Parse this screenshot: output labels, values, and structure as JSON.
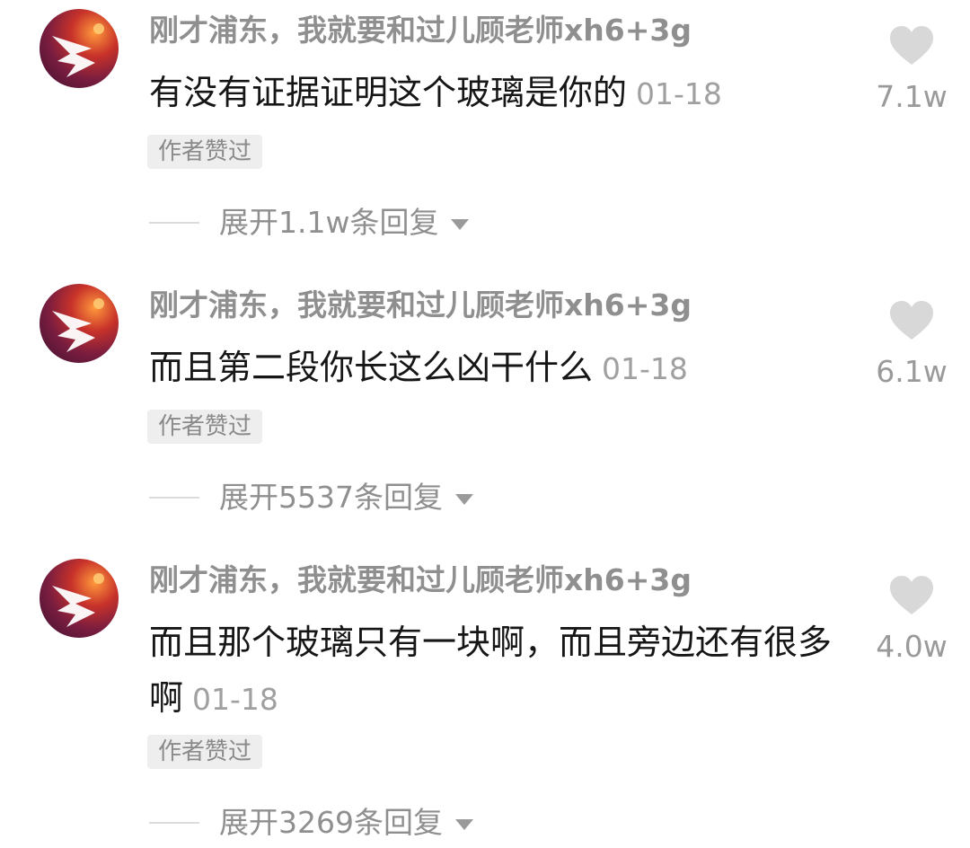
{
  "comments": [
    {
      "username": "刚才浦东，我就要和过儿顾老师xh6+3g",
      "text": "有没有证据证明这个玻璃是你的",
      "date": "01-18",
      "likes": "7.1w",
      "badge": "作者赞过",
      "expand": "展开1.1w条回复"
    },
    {
      "username": "刚才浦东，我就要和过儿顾老师xh6+3g",
      "text": "而且第二段你长这么凶干什么",
      "date": "01-18",
      "likes": "6.1w",
      "badge": "作者赞过",
      "expand": "展开5537条回复"
    },
    {
      "username": "刚才浦东，我就要和过儿顾老师xh6+3g",
      "text": "而且那个玻璃只有一块啊，而且旁边还有很多啊",
      "date": "01-18",
      "likes": "4.0w",
      "badge": "作者赞过",
      "expand": "展开3269条回复"
    }
  ],
  "icons": {
    "heart": "heart-icon",
    "expand": "triangle-down-icon",
    "avatar": "avatar-image"
  },
  "colors": {
    "username": "#8f8f8f",
    "text": "#161616",
    "meta": "#a0a0a0",
    "heart": "#d8d8d8",
    "badge_bg": "#eeeeee"
  }
}
